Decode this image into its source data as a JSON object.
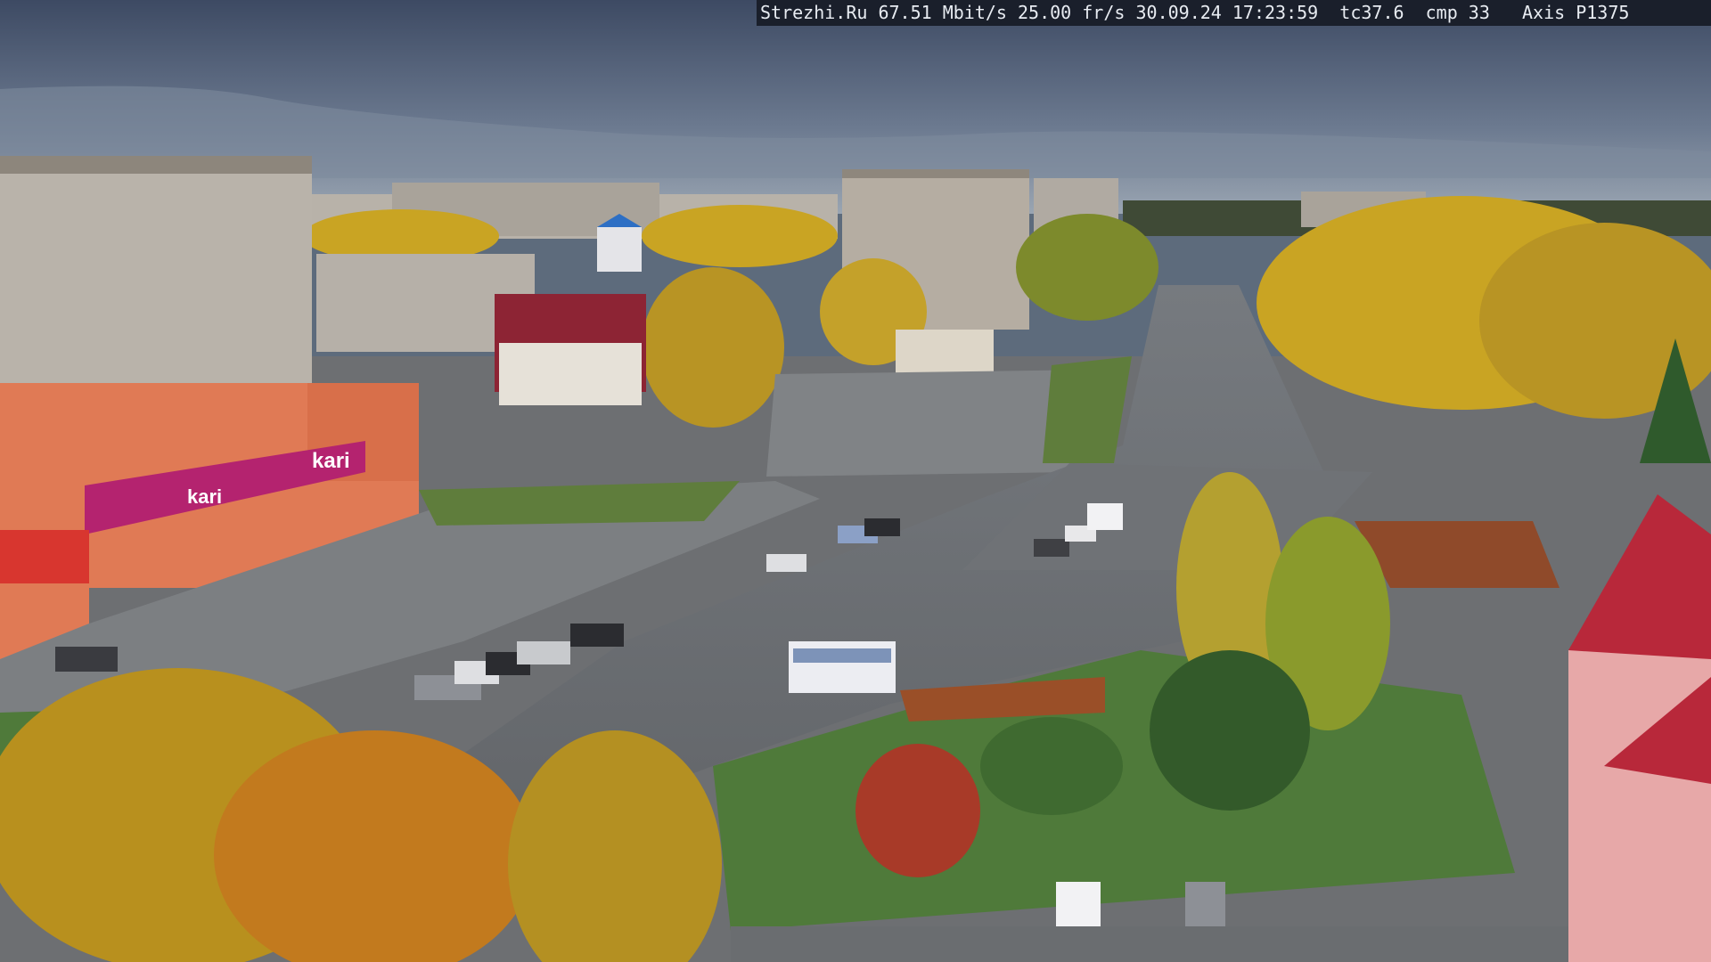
{
  "overlay": {
    "site": "Strezhi.Ru",
    "bitrate": "67.51 Mbit/s",
    "framerate": "25.00 fr/s",
    "date": "30.09.24",
    "time": "17:23:59",
    "tc": "tc37.6",
    "cmp": "cmp 33",
    "camera": "Axis P1375"
  },
  "signs": {
    "store_brand": "kari",
    "store_banner": "kari"
  },
  "palette": {
    "sky_top": "#3d4a63",
    "sky_bottom": "#8c99a9",
    "asphalt": "#6b6e72",
    "grass": "#4f7a3a",
    "foliage_yellow": "#c9a423",
    "foliage_orange": "#c77a1f",
    "store_magenta": "#b4236f",
    "store_facade": "#e07a55",
    "roof_red": "#b8283a"
  }
}
